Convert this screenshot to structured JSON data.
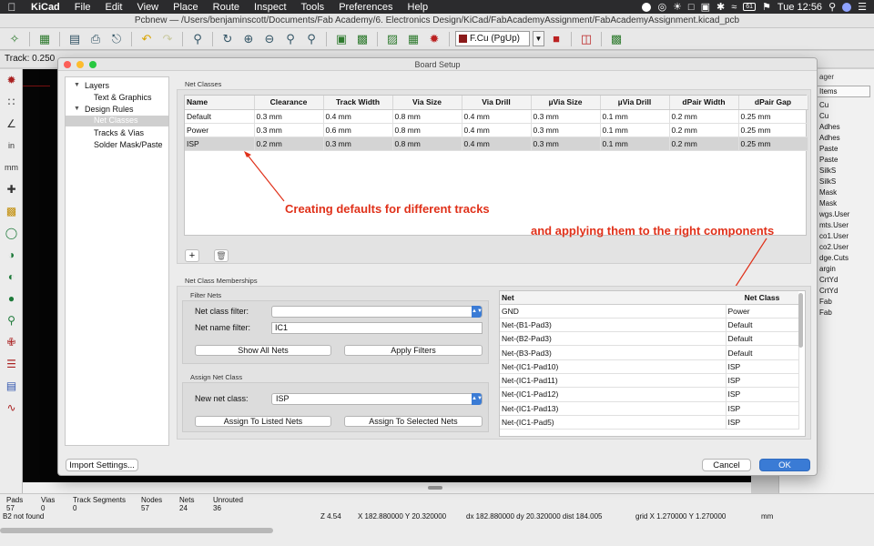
{
  "menubar": {
    "app": "KiCad",
    "items": [
      "File",
      "Edit",
      "View",
      "Place",
      "Route",
      "Inspect",
      "Tools",
      "Preferences",
      "Help"
    ],
    "battery": "61",
    "clock": "Tue 12:56"
  },
  "window_title": "Pcbnew — /Users/benjaminscott/Documents/Fab Academy/6. Electronics Design/KiCad/FabAcademyAssignment/FabAcademyAssignment.kicad_pcb",
  "toolbar": {
    "layer_select": "F.Cu (PgUp)"
  },
  "track_label": "Track: 0.250",
  "right_panel": {
    "header_partial": "ager",
    "tab": "Items",
    "layers": [
      "Cu",
      "Cu",
      "Adhes",
      "Adhes",
      "Paste",
      "Paste",
      "SilkS",
      "SilkS",
      "Mask",
      "Mask",
      "wgs.User",
      "mts.User",
      "co1.User",
      "co2.User",
      "dge.Cuts",
      "argin",
      "CrtYd",
      "CrtYd",
      "Fab",
      "Fab"
    ]
  },
  "statusbar": {
    "pads_label": "Pads",
    "pads_value": "57",
    "vias_label": "Vias",
    "vias_value": "0",
    "track_segments_label": "Track Segments",
    "track_segments_value": "0",
    "nodes_label": "Nodes",
    "nodes_value": "57",
    "nets_label": "Nets",
    "nets_value": "24",
    "unrouted_label": "Unrouted",
    "unrouted_value": "36",
    "message": "B2 not found",
    "zoom": "Z 4.54",
    "xy": "X 182.880000  Y 20.320000",
    "delta": "dx 182.880000  dy 20.320000  dist 184.005",
    "grid": "grid X 1.270000  Y 1.270000",
    "units": "mm"
  },
  "dialog": {
    "title": "Board Setup",
    "tree": {
      "layers": "Layers",
      "text_graphics": "Text & Graphics",
      "design_rules": "Design Rules",
      "net_classes": "Net Classes",
      "tracks_vias": "Tracks & Vias",
      "solder_mask": "Solder Mask/Paste"
    },
    "net_classes_label": "Net Classes",
    "net_classes_headers": [
      "Name",
      "Clearance",
      "Track Width",
      "Via Size",
      "Via Drill",
      "µVia Size",
      "µVia Drill",
      "dPair Width",
      "dPair Gap"
    ],
    "net_classes_rows": [
      [
        "Default",
        "0.3 mm",
        "0.4 mm",
        "0.8 mm",
        "0.4 mm",
        "0.3 mm",
        "0.1 mm",
        "0.2 mm",
        "0.25 mm"
      ],
      [
        "Power",
        "0.3 mm",
        "0.6 mm",
        "0.8 mm",
        "0.4 mm",
        "0.3 mm",
        "0.1 mm",
        "0.2 mm",
        "0.25 mm"
      ],
      [
        "ISP",
        "0.2 mm",
        "0.3 mm",
        "0.8 mm",
        "0.4 mm",
        "0.3 mm",
        "0.1 mm",
        "0.2 mm",
        "0.25 mm"
      ]
    ],
    "add_icon": "+",
    "annotation_1": "Creating defaults for different tracks",
    "annotation_2": "and applying them to the right components",
    "memberships_label": "Net Class Memberships",
    "filter_nets_label": "Filter Nets",
    "net_class_filter_label": "Net class filter:",
    "net_class_filter_value": "",
    "net_name_filter_label": "Net name filter:",
    "net_name_filter_value": "IC1",
    "show_all_nets": "Show All Nets",
    "apply_filters": "Apply Filters",
    "assign_net_class_label": "Assign Net Class",
    "new_net_class_label": "New net class:",
    "new_net_class_value": "ISP",
    "assign_listed": "Assign To Listed Nets",
    "assign_selected": "Assign To Selected Nets",
    "net_headers": [
      "Net",
      "Net Class"
    ],
    "net_rows": [
      [
        "GND",
        "Power"
      ],
      [
        "Net-(B1-Pad3)",
        "Default"
      ],
      [
        "Net-(B2-Pad3)",
        "Default"
      ],
      [
        "Net-(B3-Pad3)",
        "Default"
      ],
      [
        "Net-(IC1-Pad10)",
        "ISP"
      ],
      [
        "Net-(IC1-Pad11)",
        "ISP"
      ],
      [
        "Net-(IC1-Pad12)",
        "ISP"
      ],
      [
        "Net-(IC1-Pad13)",
        "ISP"
      ],
      [
        "Net-(IC1-Pad5)",
        "ISP"
      ]
    ],
    "import_settings": "Import Settings...",
    "cancel": "Cancel",
    "ok": "OK"
  },
  "colors": {
    "accent": "#3a7bd5",
    "annotation": "#e0311a",
    "canvas": "#050505"
  }
}
